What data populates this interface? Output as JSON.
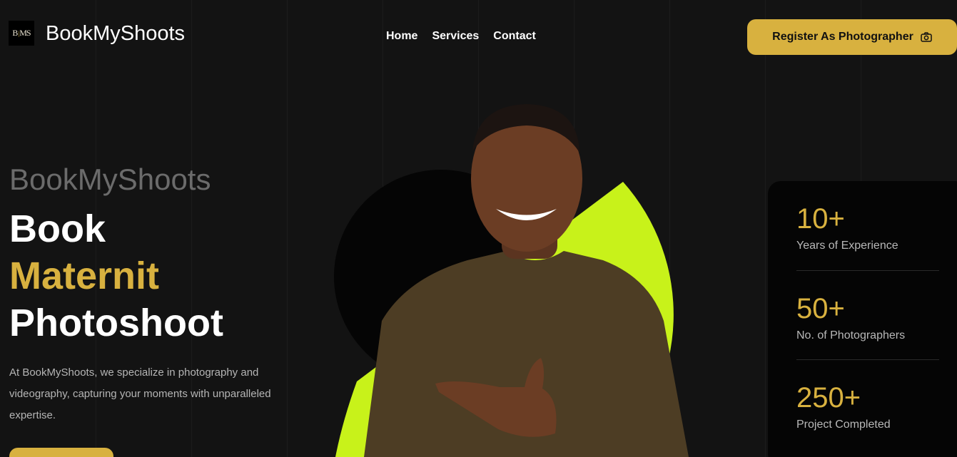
{
  "header": {
    "logo_text": "BMS",
    "brand": "BookMyShoots",
    "nav": [
      {
        "label": "Home"
      },
      {
        "label": "Services"
      },
      {
        "label": "Contact"
      }
    ],
    "cta": {
      "label": "Register As Photographer",
      "icon": "camera-icon"
    }
  },
  "hero": {
    "kicker": "BookMyShoots",
    "headline_line1": "Book",
    "headline_accent": "Maternit",
    "headline_line3": "Photoshoot",
    "description": "At BookMyShoots, we specialize in photography and videography, capturing your moments with unparalleled expertise.",
    "image": "smiling-man-pointing-photo"
  },
  "stats": [
    {
      "value": "10+",
      "label": "Years of Experience"
    },
    {
      "value": "50+",
      "label": "No. of Photographers"
    },
    {
      "value": "250+",
      "label": "Project Completed"
    }
  ],
  "colors": {
    "background": "#131313",
    "accent_gold": "#d8b13f",
    "accent_lime": "#c8f21a",
    "stats_bg": "#050505"
  }
}
